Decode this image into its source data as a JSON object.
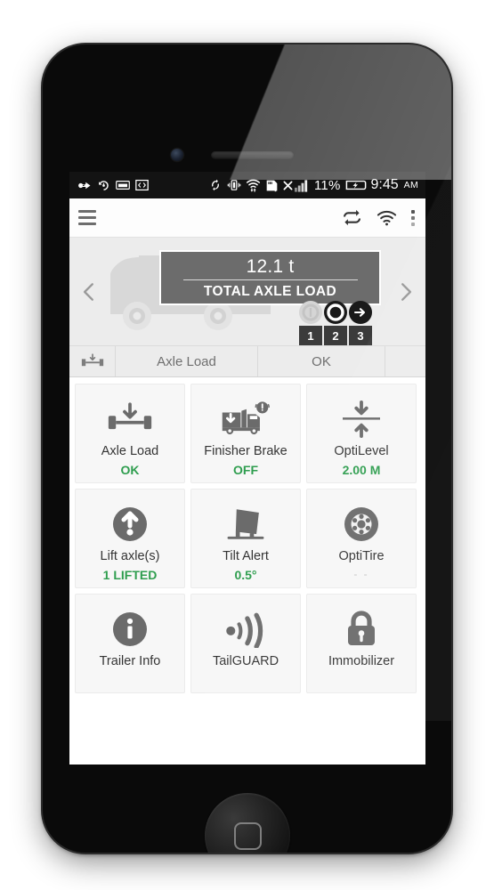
{
  "status_bar": {
    "icons_left": [
      "usb-debugging-icon",
      "sync-rotate-icon",
      "screenshot-icon",
      "developer-code-icon"
    ],
    "icons_mid": [
      "sync-icon",
      "vibrate-icon",
      "wifi-transfer-icon",
      "sd-card-warning-icon",
      "no-sim-icon",
      "signal-bars-icon"
    ],
    "battery_percent": "11%",
    "battery_icon": "battery-charging-icon",
    "time": "9:45",
    "ampm": "AM"
  },
  "app_bar": {
    "menu_icon": "hamburger-menu-icon",
    "actions": [
      {
        "icon": "sync-refresh-icon"
      },
      {
        "icon": "wifi-icon"
      },
      {
        "icon": "overflow-menu-icon"
      }
    ]
  },
  "hero": {
    "prev_icon": "chevron-left-icon",
    "next_icon": "chevron-right-icon",
    "vehicle_icon": "truck-trailer-silhouette",
    "load_value": "12.1 t",
    "load_label": "TOTAL AXLE LOAD",
    "axles": [
      {
        "number": "1",
        "state": "inactive",
        "icon": "axle-lifted-icon"
      },
      {
        "number": "2",
        "state": "active",
        "icon": "axle-loaded-icon"
      },
      {
        "number": "3",
        "state": "active",
        "icon": "axle-steer-icon"
      }
    ]
  },
  "tab_row": {
    "icon": "axle-load-icon",
    "name": "Axle Load",
    "status": "OK"
  },
  "cards": [
    {
      "icon": "axle-load-icon",
      "title": "Axle Load",
      "sub": "OK",
      "sub_style": "green"
    },
    {
      "icon": "finisher-brake-icon",
      "title": "Finisher Brake",
      "sub": "OFF",
      "sub_style": "green"
    },
    {
      "icon": "optilevel-icon",
      "title": "OptiLevel",
      "sub": "2.00 M",
      "sub_style": "green"
    },
    {
      "icon": "lift-axle-icon",
      "title": "Lift axle(s)",
      "sub": "1 LIFTED",
      "sub_style": "green"
    },
    {
      "icon": "tilt-alert-icon",
      "title": "Tilt Alert",
      "sub": "0.5°",
      "sub_style": "green"
    },
    {
      "icon": "optitire-icon",
      "title": "OptiTire",
      "sub": "- -",
      "sub_style": "muted"
    },
    {
      "icon": "trailer-info-icon",
      "title": "Trailer Info",
      "sub": "",
      "sub_style": "blank"
    },
    {
      "icon": "tailguard-icon",
      "title": "TailGUARD",
      "sub": "",
      "sub_style": "blank"
    },
    {
      "icon": "immobilizer-icon",
      "title": "Immobilizer",
      "sub": "",
      "sub_style": "blank"
    }
  ],
  "colors": {
    "status_green": "#2f9e4f",
    "badge_gray": "#6c6c6c",
    "panel_gray": "#ececec",
    "icon_gray": "#6b6b6b"
  }
}
